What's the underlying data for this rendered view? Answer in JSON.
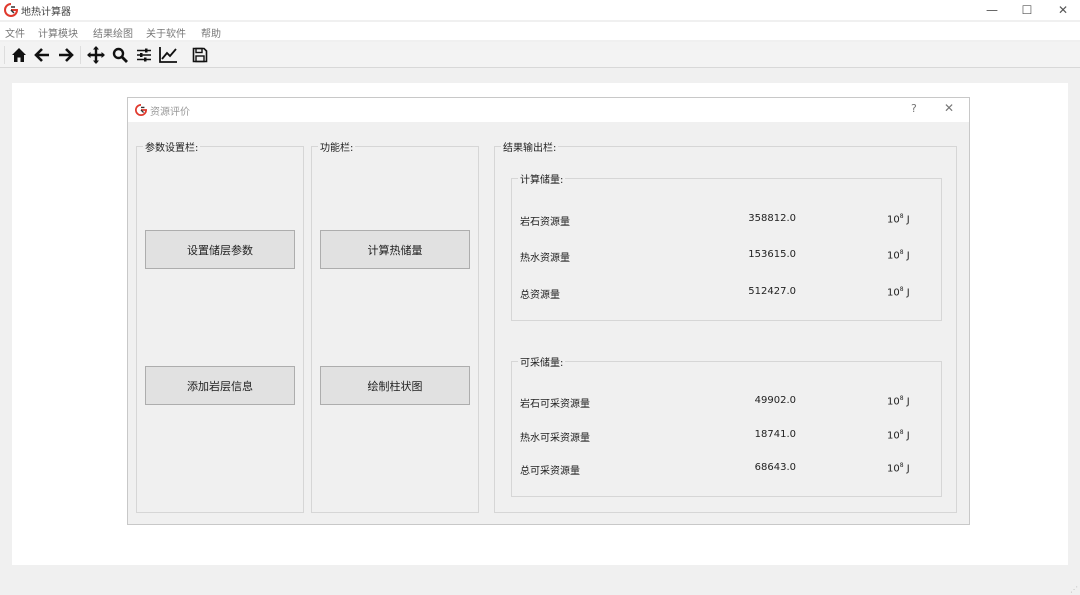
{
  "window": {
    "title": "地热计算器",
    "controls": {
      "minimize": "—",
      "maximize": "☐",
      "close": "✕"
    }
  },
  "menu": {
    "items": [
      "文件",
      "计算模块",
      "结果绘图",
      "关于软件",
      "帮助"
    ]
  },
  "toolbar": {
    "icons": [
      "home-icon",
      "back-arrow-icon",
      "forward-arrow-icon",
      "pan-icon",
      "zoom-icon",
      "configure-subplots-icon",
      "edit-axis-icon",
      "save-icon"
    ]
  },
  "dialog": {
    "title": "资源评价",
    "help": "?",
    "close": "✕",
    "params_group": {
      "title": "参数设置栏:",
      "set_layer_button": "设置储层参数",
      "add_rock_button": "添加岩层信息"
    },
    "function_group": {
      "title": "功能栏:",
      "calc_heat_button": "计算热储量",
      "draw_bar_button": "绘制柱状图"
    },
    "output_group": {
      "title": "结果输出栏:",
      "reserve": {
        "title": "计算储量:",
        "rows": [
          {
            "label": "岩石资源量",
            "value": "358812.0",
            "unit_base": "10",
            "unit_exp": "8",
            "unit_suffix": " J"
          },
          {
            "label": "热水资源量",
            "value": "153615.0",
            "unit_base": "10",
            "unit_exp": "8",
            "unit_suffix": " J"
          },
          {
            "label": "总资源量",
            "value": "512427.0",
            "unit_base": "10",
            "unit_exp": "8",
            "unit_suffix": " J"
          }
        ]
      },
      "recoverable": {
        "title": "可采储量:",
        "rows": [
          {
            "label": "岩石可采资源量",
            "value": "49902.0",
            "unit_base": "10",
            "unit_exp": "8",
            "unit_suffix": " J"
          },
          {
            "label": "热水可采资源量",
            "value": "18741.0",
            "unit_base": "10",
            "unit_exp": "8",
            "unit_suffix": " J"
          },
          {
            "label": "总可采资源量",
            "value": "68643.0",
            "unit_base": "10",
            "unit_exp": "8",
            "unit_suffix": " J"
          }
        ]
      }
    }
  },
  "colors": {
    "logo_red": "#e03a2e",
    "logo_dark": "#333333",
    "button_face": "#e1e1e1",
    "button_border": "#adadad"
  }
}
